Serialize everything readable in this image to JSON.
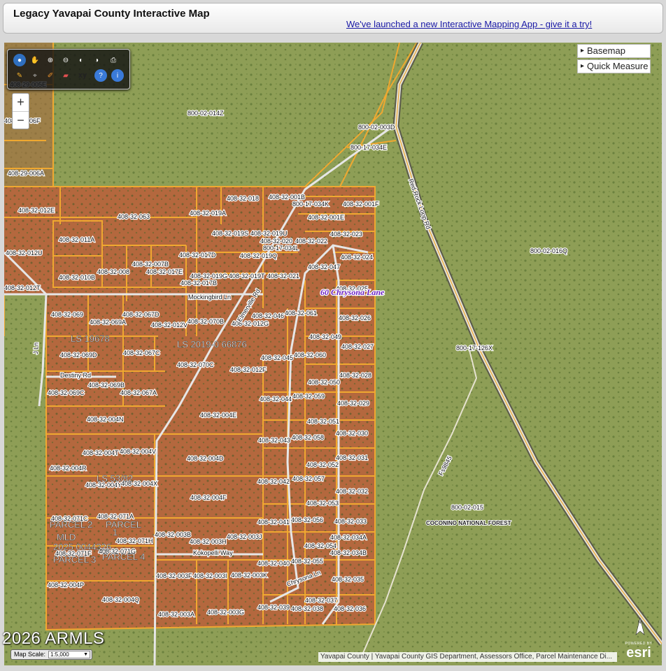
{
  "header": {
    "title": "Legacy Yavapai County Interactive Map",
    "promo_link": "We've launched a new Interactive Mapping App - give it a try!"
  },
  "map_controls": {
    "basemap": "Basemap",
    "quick_measure": "Quick Measure",
    "zoom_in": "+",
    "zoom_out": "−",
    "toolbar_xy": "xy",
    "scale_label": "Map Scale:",
    "scale_value": "1:5,000"
  },
  "colors": {
    "parcel_line": "#f0a830",
    "terrain_green": "#8c9c54",
    "terrain_red": "#b0643a",
    "road": "#e8e8e8",
    "highlight_text": "#6a1fc4"
  },
  "map": {
    "highlight_address": "60 Chrysona Lane",
    "watermark": "2026 ARMLS",
    "attribution": "Yavapai County | Yavapai County GIS Department, Assessors Office, Parcel Maintenance Di...",
    "esri_powered": "POWERED BY",
    "esri_logo": "esri",
    "north_label": "N",
    "forest_label": "COCONINO NATIONAL FOREST",
    "road_labels": [
      "Mockingbird Ln",
      "Destiny Rd",
      "Elmerville Rd",
      "Kokopelli Way",
      "Chrysona Ln",
      "Red Rock Loop Rd",
      "J Ln",
      "Fs9845"
    ],
    "overlay_labels": [
      "LS 19678",
      "LS 2019-0 66876",
      "LS 53/82",
      "PARCEL 2",
      "PARCEL 3",
      "PARCEL 1",
      "MLD",
      "2025 0044326",
      "PARCEL",
      "PARCEL 4"
    ],
    "parcels": [
      "408-29-005E",
      "800-02-014Z",
      "408-29-006F",
      "408-29-006A",
      "800-02-003D",
      "800-17-034E",
      "408-32-012E",
      "408-32-063",
      "408-32-019A",
      "408-32-018",
      "408-32-001B",
      "800-17-034K",
      "408-32-001F",
      "408-32-001E",
      "408-32-011A",
      "408-32-019S",
      "408-32-019U",
      "408-32-020",
      "408-32-022",
      "408-32-023",
      "800-17-034L",
      "408-32-012U",
      "408-32-017D",
      "408-32-019Q",
      "408-32-024",
      "408-32-007B",
      "408-32-008",
      "408-32-017E",
      "408-32-047",
      "408-32-010B",
      "408-32-019G",
      "408-32-019T",
      "408-32-021",
      "408-32-017B",
      "408-32-012T",
      "408-32-025",
      "408-32-069",
      "408-32-067D",
      "408-32-046",
      "408-32-061",
      "408-32-026",
      "408-32-069A",
      "408-32-012V",
      "408-32-070B",
      "408-32-012G",
      "408-32-049",
      "408-32-027",
      "408-32-069D",
      "408-32-067C",
      "408-32-045",
      "408-32-060",
      "408-32-070C",
      "408-32-012F",
      "408-32-028",
      "408-32-050",
      "408-32-069B",
      "408-32-069C",
      "408-32-067A",
      "408-32-044",
      "408-32-059",
      "408-32-029",
      "408-32-004N",
      "408-32-004E",
      "408-32-051",
      "408-32-030",
      "408-32-043",
      "408-32-058",
      "408-32-004T",
      "408-32-004V",
      "408-32-004D",
      "408-32-031",
      "408-32-004R",
      "408-32-052",
      "408-32-057",
      "408-32-004Y",
      "408-32-004X",
      "408-32-042",
      "408-32-032",
      "408-32-004F",
      "408-32-053",
      "408-32-071C",
      "408-32-071A",
      "408-32-041",
      "408-32-056",
      "408-32-033",
      "408-32-003B",
      "408-32-071H",
      "408-32-003H",
      "408-32-003J",
      "408-32-034A",
      "408-32-054",
      "408-32-071F",
      "408-32-071G",
      "408-32-034B",
      "408-32-040",
      "408-32-055",
      "408-32-003F",
      "408-32-003I",
      "408-32-003K",
      "408-32-035",
      "408-32-004P",
      "408-32-004Q",
      "408-32-039",
      "408-32-037",
      "408-32-038",
      "408-32-036",
      "408-32-003A",
      "408-32-003G",
      "800-02-016Q",
      "800-17-126X",
      "800-02-015"
    ]
  }
}
